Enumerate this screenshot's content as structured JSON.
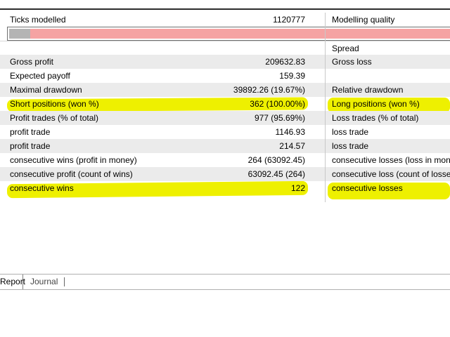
{
  "rows": [
    {
      "label": "Ticks modelled",
      "value": "1120777",
      "right": "Modelling quality"
    },
    {
      "label": "",
      "value": "",
      "right": "Spread"
    },
    {
      "label": "Gross profit",
      "value": "209632.83",
      "right": "Gross loss"
    },
    {
      "label": "Expected payoff",
      "value": "159.39",
      "right": ""
    },
    {
      "label": "Maximal drawdown",
      "value": "39892.26 (19.67%)",
      "right": "Relative drawdown"
    },
    {
      "label": "Short positions (won %)",
      "value": "362 (100.00%)",
      "right": "Long positions (won %)"
    },
    {
      "label": "Profit trades (% of total)",
      "value": "977 (95.69%)",
      "right": "Loss trades (% of total)"
    },
    {
      "label": "profit trade",
      "value": "1146.93",
      "right": "loss trade"
    },
    {
      "label": "profit trade",
      "value": "214.57",
      "right": "loss trade"
    },
    {
      "label": "consecutive wins (profit in money)",
      "value": "264 (63092.45)",
      "right": "consecutive losses (loss in money)"
    },
    {
      "label": "consecutive profit (count of wins)",
      "value": "63092.45 (264)",
      "right": "consecutive loss (count of losses)"
    },
    {
      "label": "consecutive wins",
      "value": "122",
      "right": "consecutive losses"
    }
  ],
  "modelling_quality_progress": 0.05,
  "tabs": {
    "report": "Report",
    "journal": "Journal"
  },
  "colors": {
    "highlight": "#eef000",
    "progress_fill": "#b4b4b4",
    "progress_rest": "#f5a3a3",
    "row_shade": "#ebebeb"
  }
}
